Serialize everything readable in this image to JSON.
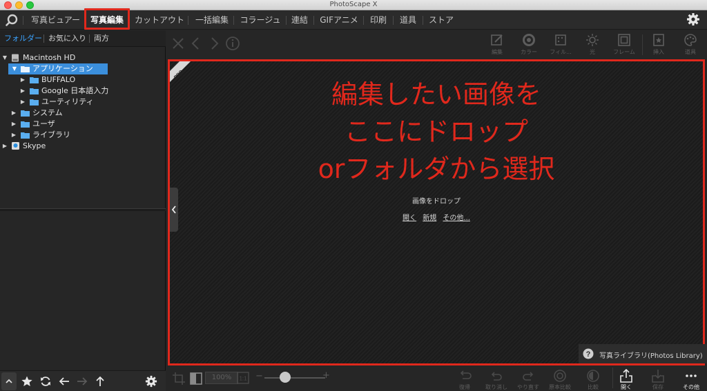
{
  "window": {
    "title": "PhotoScape X"
  },
  "nav": {
    "tabs": [
      {
        "label": "写真ビュアー"
      },
      {
        "label": "写真編集"
      },
      {
        "label": "カットアウト"
      },
      {
        "label": "一括編集"
      },
      {
        "label": "コラージュ"
      },
      {
        "label": "連結"
      },
      {
        "label": "GIFアニメ"
      },
      {
        "label": "印刷"
      },
      {
        "label": "道具"
      },
      {
        "label": "ストア"
      }
    ],
    "active_tab": "写真編集"
  },
  "left_panel": {
    "tabs": [
      {
        "label": "フォルダー"
      },
      {
        "label": "お気に入り"
      },
      {
        "label": "両方"
      }
    ],
    "tree": [
      {
        "label": "Macintosh HD"
      },
      {
        "label": "アプリケーション"
      },
      {
        "label": "BUFFALO"
      },
      {
        "label": "Google 日本語入力"
      },
      {
        "label": "ユーティリティ"
      },
      {
        "label": "システム"
      },
      {
        "label": "ユーザ"
      },
      {
        "label": "ライブラリ"
      },
      {
        "label": "Skype"
      }
    ]
  },
  "edit_tools": [
    {
      "label": "編集"
    },
    {
      "label": "カラー"
    },
    {
      "label": "フィル..."
    },
    {
      "label": "光"
    },
    {
      "label": "フレーム"
    },
    {
      "label": "挿入"
    },
    {
      "label": "道具"
    }
  ],
  "canvas": {
    "pro_badge": "PRO",
    "instruction_lines": [
      "編集したい画像を",
      "ここにドロップ",
      "orフォルダから選択"
    ],
    "drop_text": "画像をドロップ",
    "links": [
      {
        "label": "開く"
      },
      {
        "label": "新規"
      },
      {
        "label": "その他..."
      }
    ],
    "photos_library": "写真ライブラリ(Photos Library)"
  },
  "bottom_toolbar": {
    "zoom": "100%",
    "buttons": [
      {
        "label": "復帰"
      },
      {
        "label": "取り消し"
      },
      {
        "label": "やり直す"
      },
      {
        "label": "原本比較"
      },
      {
        "label": "比較"
      },
      {
        "label": "開く"
      },
      {
        "label": "保存"
      },
      {
        "label": "その他"
      }
    ]
  },
  "colors": {
    "highlight_red": "#e0281c",
    "selection_blue": "#3b8fdc",
    "active_tab_blue": "#3ba3ff"
  }
}
